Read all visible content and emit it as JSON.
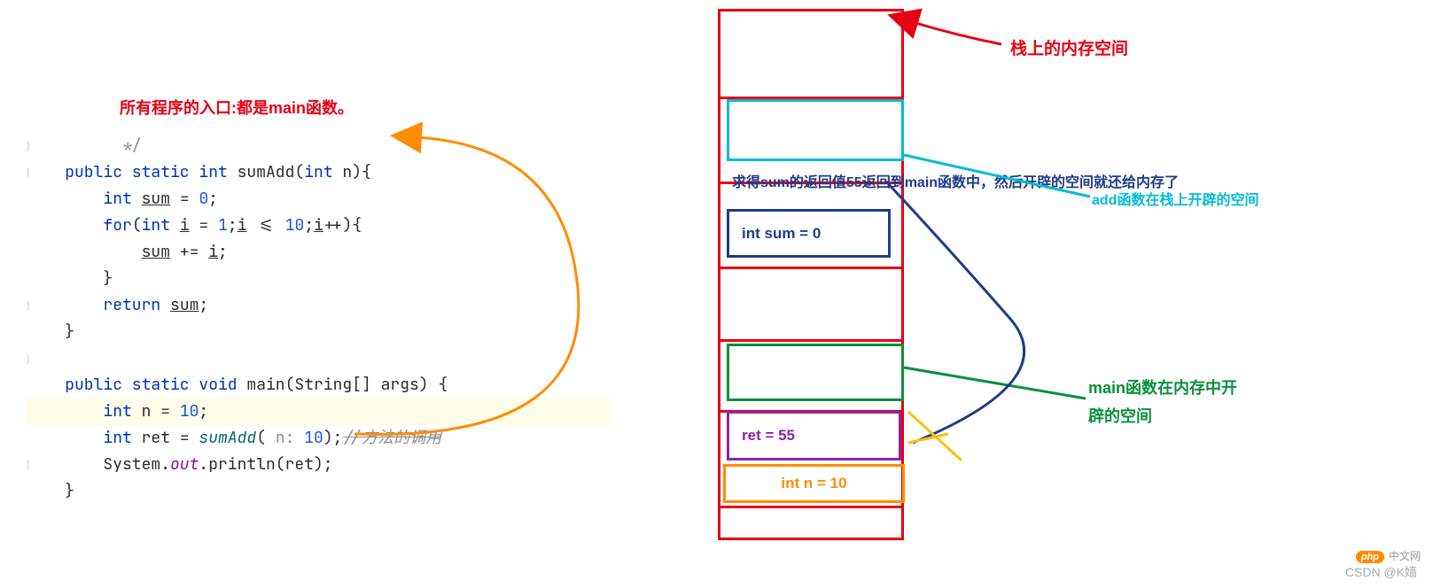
{
  "annotations": {
    "title": "所有程序的入口:都是main函数。",
    "stack_label": "栈上的内存空间",
    "sum_return": "求得sum的返回值55返回到main函数中，然后开辟的空间就还给内存了",
    "add_space": "add函数在栈上开辟的空间",
    "main_space_l1": "main函数在内存中开",
    "main_space_l2": "辟的空间"
  },
  "stack": {
    "int_sum": "int sum = 0",
    "ret": "ret = 55",
    "int_n": "int n = 10"
  },
  "code": {
    "l0": "          */",
    "l1_a": "    public static ",
    "l1_b": "int",
    "l1_c": " sumAdd(",
    "l1_d": "int",
    "l1_e": " n){",
    "l2_a": "        ",
    "l2_b": "int",
    "l2_c": " ",
    "l2_d": "sum",
    "l2_e": " = ",
    "l2_f": "0",
    "l2_g": ";",
    "l3_a": "        ",
    "l3_b": "for",
    "l3_c": "(",
    "l3_d": "int",
    "l3_e": " ",
    "l3_f": "i",
    "l3_g": " = ",
    "l3_h": "1",
    "l3_i": ";",
    "l3_j": "i",
    "l3_k": " <= ",
    "l3_l": "10",
    "l3_m": ";",
    "l3_n": "i",
    "l3_o": "++){",
    "l4_a": "            ",
    "l4_b": "sum",
    "l4_c": " += ",
    "l4_d": "i",
    "l4_e": ";",
    "l5": "        }",
    "l6_a": "        ",
    "l6_b": "return",
    "l6_c": " ",
    "l6_d": "sum",
    "l6_e": ";",
    "l7": "    }",
    "l8": "",
    "l9_a": "    public static ",
    "l9_b": "void",
    "l9_c": " main(String[] args) {",
    "l10_a": "        ",
    "l10_b": "int",
    "l10_c": " n = ",
    "l10_d": "10",
    "l10_e": ";",
    "l11_a": "        ",
    "l11_b": "int",
    "l11_c": " ret = ",
    "l11_d": "sumAdd",
    "l11_e": "(",
    "l11_f": " n: ",
    "l11_g": "10",
    "l11_h": ");",
    "l11_i": "//方法的调用",
    "l12_a": "        System.",
    "l12_b": "out",
    "l12_c": ".println(ret);",
    "l13": "    }"
  },
  "watermark": "CSDN @K嫱",
  "php_badge": "php",
  "php_text": "中文网"
}
